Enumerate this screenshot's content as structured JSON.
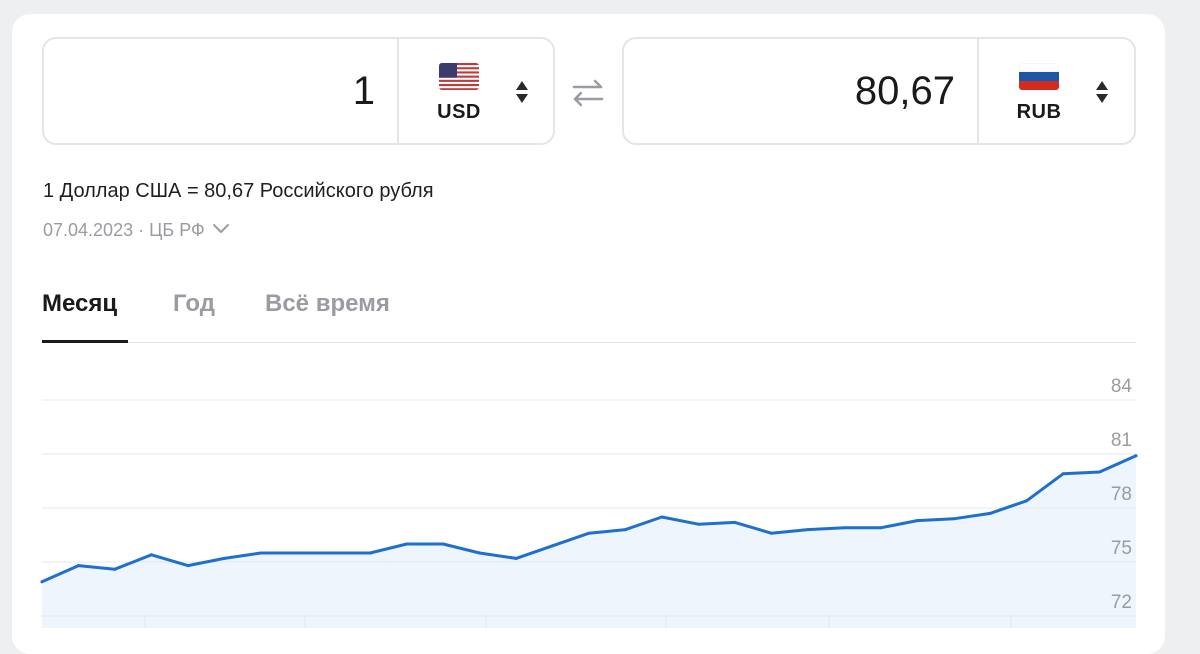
{
  "converter": {
    "from": {
      "amount": "1",
      "code": "USD",
      "flag": "us-flag-icon"
    },
    "to": {
      "amount": "80,67",
      "code": "RUB",
      "flag": "ru-flag-icon"
    },
    "swap_icon": "swap-arrows-icon"
  },
  "rate_text": "1 Доллар США = 80,67 Российского рубля",
  "date_source": "07.04.2023 · ЦБ РФ",
  "tabs": [
    {
      "label": "Месяц",
      "active": true
    },
    {
      "label": "Год",
      "active": false
    },
    {
      "label": "Всё время",
      "active": false
    }
  ],
  "colors": {
    "line": "#1f6fd1",
    "fill": "#eef5fd",
    "grid": "#e6e7ea",
    "text_muted": "#9a9ca1"
  },
  "chart_data": {
    "type": "area",
    "y_ticks": [
      84,
      81,
      78,
      75,
      72
    ],
    "ylim": [
      72,
      84
    ],
    "grid": true,
    "values": [
      73.9,
      74.8,
      74.6,
      75.4,
      74.8,
      75.2,
      75.5,
      75.5,
      75.5,
      75.5,
      76.0,
      76.0,
      75.5,
      75.2,
      75.9,
      76.6,
      76.8,
      77.5,
      77.1,
      77.2,
      76.6,
      76.8,
      76.9,
      76.9,
      77.3,
      77.4,
      77.7,
      78.4,
      79.9,
      80.0,
      80.9
    ]
  }
}
